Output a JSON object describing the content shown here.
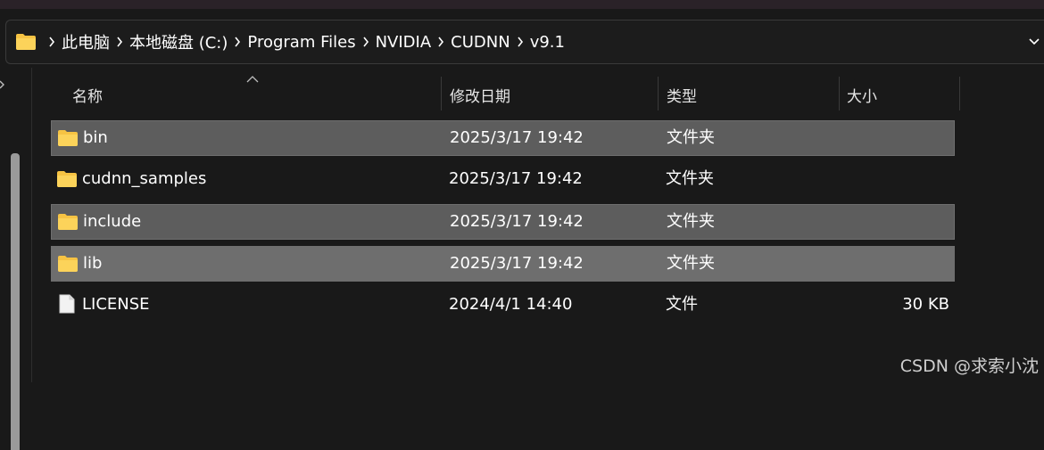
{
  "address": {
    "path": [
      "此电脑",
      "本地磁盘 (C:)",
      "Program Files",
      "NVIDIA",
      "CUDNN",
      "v9.1"
    ]
  },
  "columns": {
    "name": "名称",
    "modified": "修改日期",
    "type": "类型",
    "size": "大小"
  },
  "files": [
    {
      "name": "bin",
      "modified": "2025/3/17 19:42",
      "type": "文件夹",
      "size": "",
      "icon": "folder-icon",
      "selected": true
    },
    {
      "name": "cudnn_samples",
      "modified": "2025/3/17 19:42",
      "type": "文件夹",
      "size": "",
      "icon": "folder-icon",
      "selected": false
    },
    {
      "name": "include",
      "modified": "2025/3/17 19:42",
      "type": "文件夹",
      "size": "",
      "icon": "folder-icon",
      "selected": true
    },
    {
      "name": "lib",
      "modified": "2025/3/17 19:42",
      "type": "文件夹",
      "size": "",
      "icon": "folder-icon",
      "selected": true
    },
    {
      "name": "LICENSE",
      "modified": "2024/4/1 14:40",
      "type": "文件",
      "size": "30 KB",
      "icon": "file-icon",
      "selected": false
    }
  ],
  "watermark": "CSDN @求索小沈",
  "colors": {
    "background": "#191919",
    "selected_row": "#5d5d5d",
    "folder_yellow": "#f6c343"
  }
}
